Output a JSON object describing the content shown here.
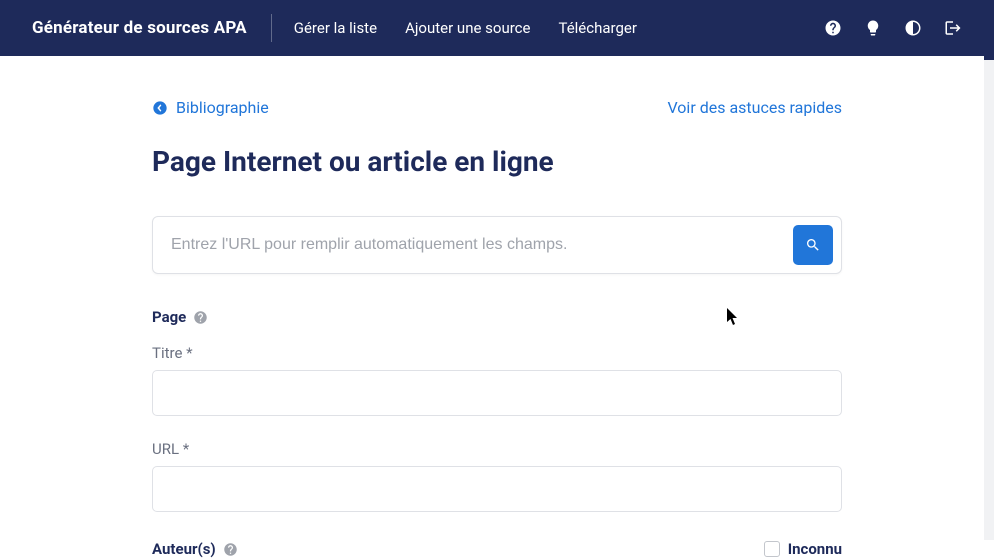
{
  "navbar": {
    "brand": "Générateur de sources APA",
    "links": {
      "manage": "Gérer la liste",
      "add": "Ajouter une source",
      "download": "Télécharger"
    }
  },
  "topRow": {
    "back": "Bibliographie",
    "tips": "Voir des astuces rapides"
  },
  "title": "Page Internet ou article en ligne",
  "search": {
    "placeholder": "Entrez l'URL pour remplir automatiquement les champs."
  },
  "page": {
    "section": "Page",
    "titleLabel": "Titre *",
    "urlLabel": "URL *"
  },
  "authors": {
    "section": "Auteur(s)",
    "unknown": "Inconnu"
  }
}
